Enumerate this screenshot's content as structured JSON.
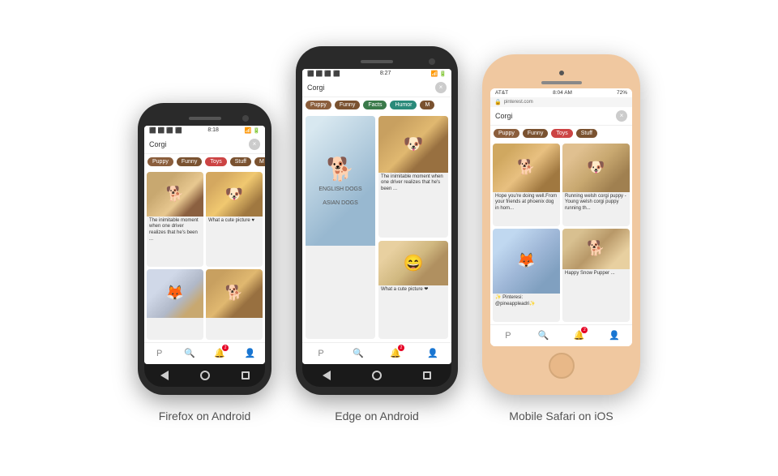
{
  "phones": [
    {
      "id": "firefox-android",
      "label": "Firefox on Android",
      "type": "android-small",
      "status": {
        "time": "8:18",
        "icons": "▲ ⬛ 📶 🔋"
      },
      "search": "Corgi",
      "tags": [
        "Puppy",
        "Funny",
        "Toys",
        "Stuff",
        "M"
      ],
      "tag_colors": [
        "brown",
        "brown2",
        "red",
        "brown2",
        "brown2"
      ],
      "pins": [
        {
          "caption": "The inimitable moment when one driver realizes that he's been ..."
        },
        {
          "caption": "What a cute picture ♥"
        },
        {
          "caption": ""
        },
        {
          "caption": ""
        }
      ]
    },
    {
      "id": "edge-android",
      "label": "Edge on Android",
      "type": "android-large",
      "status": {
        "time": "8:27"
      },
      "search": "Corgi",
      "tags": [
        "Puppy",
        "Funny",
        "Facts",
        "Humor",
        "M"
      ],
      "tag_colors": [
        "brown",
        "brown2",
        "green",
        "teal",
        "brown2"
      ],
      "pins": [
        {
          "caption": ""
        },
        {
          "caption": "The inimitable moment when one driver realizes that he's been ..."
        },
        {
          "caption": ""
        },
        {
          "caption": "What a cute picture ❤"
        }
      ]
    },
    {
      "id": "ios-safari",
      "label": "Mobile Safari on iOS",
      "type": "ios",
      "status": {
        "carrier": "AT&T",
        "time": "8:04 AM",
        "wifi": "◈ ▲",
        "battery": "72%"
      },
      "url": "pinterest.com",
      "search": "Corgi",
      "tags": [
        "Puppy",
        "Funny",
        "Toys",
        "Stuff"
      ],
      "tag_colors": [
        "brown",
        "brown2",
        "red",
        "brown2"
      ],
      "pins": [
        {
          "caption": "Hope you're doing well.From your friends at phoenix dog in hom..."
        },
        {
          "caption": "Running welsh corgi puppy - Young welsh corgi puppy running th..."
        },
        {
          "caption": "✨ Pinteresi: @pineappleadri✨"
        },
        {
          "caption": "Happy Snow Pupper ..."
        }
      ]
    }
  ],
  "icons": {
    "pinterest": "P",
    "search": "🔍",
    "notifications": "🔔",
    "profile": "👤",
    "back": "◀",
    "circle": "●",
    "square": "■",
    "lock": "🔒",
    "close": "×"
  }
}
